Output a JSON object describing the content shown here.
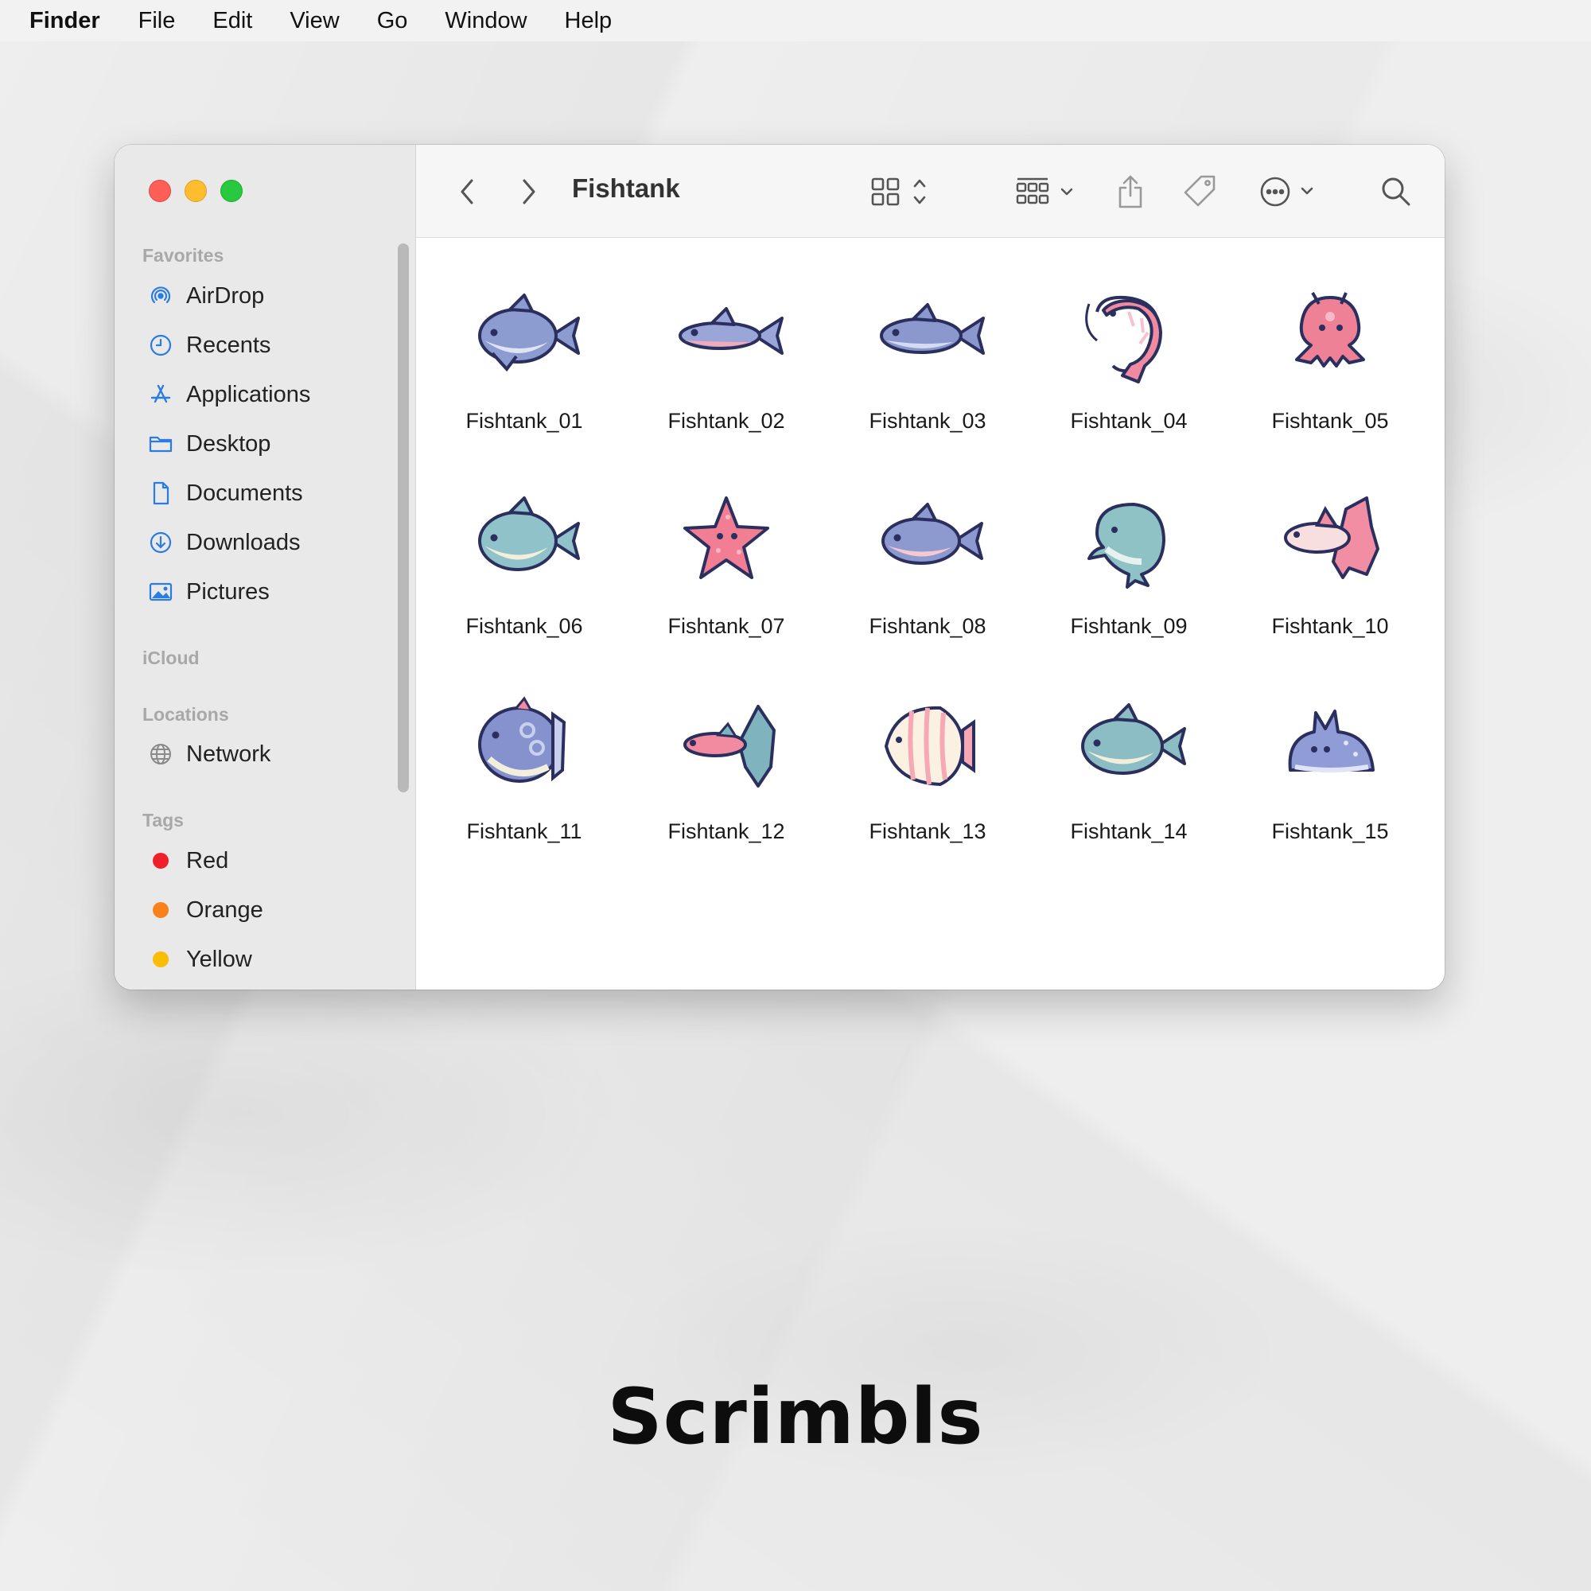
{
  "menubar": {
    "app": "Finder",
    "items": [
      "File",
      "Edit",
      "View",
      "Go",
      "Window",
      "Help"
    ]
  },
  "window": {
    "title": "Fishtank",
    "toolbar_icons": [
      "back-chevron-icon",
      "forward-chevron-icon",
      "icon-view-icon",
      "group-icon",
      "share-icon",
      "tag-icon",
      "more-icon",
      "search-icon"
    ]
  },
  "sidebar": {
    "favorites_label": "Favorites",
    "favorites": [
      {
        "label": "AirDrop",
        "icon": "airdrop-icon"
      },
      {
        "label": "Recents",
        "icon": "clock-icon"
      },
      {
        "label": "Applications",
        "icon": "applications-icon"
      },
      {
        "label": "Desktop",
        "icon": "folder-icon"
      },
      {
        "label": "Documents",
        "icon": "document-icon"
      },
      {
        "label": "Downloads",
        "icon": "download-icon"
      },
      {
        "label": "Pictures",
        "icon": "pictures-icon"
      }
    ],
    "icloud_label": "iCloud",
    "locations_label": "Locations",
    "locations": [
      {
        "label": "Network",
        "icon": "network-icon"
      }
    ],
    "tags_label": "Tags",
    "tags": [
      {
        "label": "Red",
        "color": "#f0202a"
      },
      {
        "label": "Orange",
        "color": "#f7821b"
      },
      {
        "label": "Yellow",
        "color": "#fbbc05"
      }
    ]
  },
  "files": [
    {
      "name": "Fishtank_01",
      "kind": "shark",
      "primary": "#8c9bd0",
      "secondary": "#dfe4f5"
    },
    {
      "name": "Fishtank_02",
      "kind": "slim-fish",
      "primary": "#9aa6d8",
      "secondary": "#f4a9b8"
    },
    {
      "name": "Fishtank_03",
      "kind": "tuna",
      "primary": "#8a98cd",
      "secondary": "#d5dbf2"
    },
    {
      "name": "Fishtank_04",
      "kind": "shrimp",
      "primary": "#f08aa0",
      "secondary": "#f7c2cd"
    },
    {
      "name": "Fishtank_05",
      "kind": "octopus",
      "primary": "#ef8197",
      "secondary": "#f7b9c5"
    },
    {
      "name": "Fishtank_06",
      "kind": "round-fish",
      "primary": "#8fc2c9",
      "secondary": "#f2f0dd"
    },
    {
      "name": "Fishtank_07",
      "kind": "starfish",
      "primary": "#f27e94",
      "secondary": "#f9b9c4"
    },
    {
      "name": "Fishtank_08",
      "kind": "tuna-belly",
      "primary": "#8d9ad0",
      "secondary": "#f6c8cf"
    },
    {
      "name": "Fishtank_09",
      "kind": "dolphin",
      "primary": "#8ec2c4",
      "secondary": "#e7f1ef"
    },
    {
      "name": "Fishtank_10",
      "kind": "betta",
      "primary": "#f28ea3",
      "secondary": "#f7dfe0"
    },
    {
      "name": "Fishtank_11",
      "kind": "sunfish",
      "primary": "#8592cd",
      "secondary": "#c9d0ee"
    },
    {
      "name": "Fishtank_12",
      "kind": "guppy",
      "primary": "#7fb3bd",
      "secondary": "#f28aa0"
    },
    {
      "name": "Fishtank_13",
      "kind": "angelfish",
      "primary": "#f6a9b4",
      "secondary": "#fbf1e3"
    },
    {
      "name": "Fishtank_14",
      "kind": "grouper",
      "primary": "#8cbcc4",
      "secondary": "#f1efdc"
    },
    {
      "name": "Fishtank_15",
      "kind": "sea-bunny",
      "primary": "#8f9cd6",
      "secondary": "#dfe4f7"
    }
  ],
  "brand": "Scrimbls"
}
